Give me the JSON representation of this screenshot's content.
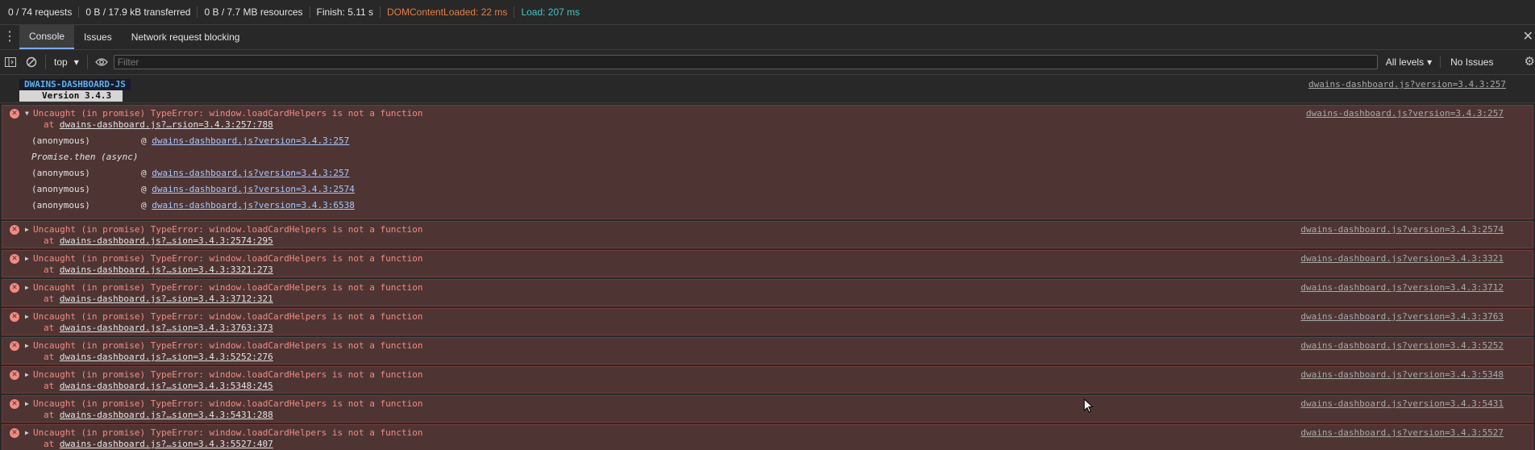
{
  "statusbar": {
    "requests": "0 / 74 requests",
    "transferred": "0 B / 17.9 kB transferred",
    "resources": "0 B / 7.7 MB resources",
    "finish": "Finish: 5.11 s",
    "dom_content_loaded": "DOMContentLoaded: 22 ms",
    "load": "Load: 207 ms"
  },
  "drawer": {
    "tabs": [
      {
        "label": "Console",
        "active": true
      },
      {
        "label": "Issues",
        "active": false
      },
      {
        "label": "Network request blocking",
        "active": false
      }
    ]
  },
  "toolbar": {
    "context": "top",
    "filter_placeholder": "Filter",
    "levels": "All levels",
    "issues": "No Issues"
  },
  "console": {
    "banner": {
      "title": "DWAINS-DASHBOARD-JS",
      "version": "Version 3.4.3",
      "source": "dwains-dashboard.js?version=3.4.3:257"
    },
    "expanded_error": {
      "message": "Uncaught (in promise) TypeError: window.loadCardHelpers is not a function",
      "at_prefix": "at ",
      "location": "dwains-dashboard.js?…rsion=3.4.3:257:788",
      "source": "dwains-dashboard.js?version=3.4.3:257",
      "stack": [
        {
          "fn": "(anonymous)",
          "at": "@",
          "link": "dwains-dashboard.js?version=3.4.3:257"
        },
        {
          "async": "Promise.then (async)"
        },
        {
          "fn": "(anonymous)",
          "at": "@",
          "link": "dwains-dashboard.js?version=3.4.3:257"
        },
        {
          "fn": "(anonymous)",
          "at": "@",
          "link": "dwains-dashboard.js?version=3.4.3:2574"
        },
        {
          "fn": "(anonymous)",
          "at": "@",
          "link": "dwains-dashboard.js?version=3.4.3:6538"
        }
      ]
    },
    "errors": [
      {
        "message": "Uncaught (in promise) TypeError: window.loadCardHelpers is not a function",
        "location": "dwains-dashboard.js?…sion=3.4.3:2574:295",
        "source": "dwains-dashboard.js?version=3.4.3:2574"
      },
      {
        "message": "Uncaught (in promise) TypeError: window.loadCardHelpers is not a function",
        "location": "dwains-dashboard.js?…sion=3.4.3:3321:273",
        "source": "dwains-dashboard.js?version=3.4.3:3321"
      },
      {
        "message": "Uncaught (in promise) TypeError: window.loadCardHelpers is not a function",
        "location": "dwains-dashboard.js?…sion=3.4.3:3712:321",
        "source": "dwains-dashboard.js?version=3.4.3:3712"
      },
      {
        "message": "Uncaught (in promise) TypeError: window.loadCardHelpers is not a function",
        "location": "dwains-dashboard.js?…sion=3.4.3:3763:373",
        "source": "dwains-dashboard.js?version=3.4.3:3763"
      },
      {
        "message": "Uncaught (in promise) TypeError: window.loadCardHelpers is not a function",
        "location": "dwains-dashboard.js?…sion=3.4.3:5252:276",
        "source": "dwains-dashboard.js?version=3.4.3:5252"
      },
      {
        "message": "Uncaught (in promise) TypeError: window.loadCardHelpers is not a function",
        "location": "dwains-dashboard.js?…sion=3.4.3:5348:245",
        "source": "dwains-dashboard.js?version=3.4.3:5348"
      },
      {
        "message": "Uncaught (in promise) TypeError: window.loadCardHelpers is not a function",
        "location": "dwains-dashboard.js?…sion=3.4.3:5431:288",
        "source": "dwains-dashboard.js?version=3.4.3:5431"
      },
      {
        "message": "Uncaught (in promise) TypeError: window.loadCardHelpers is not a function",
        "location": "dwains-dashboard.js?…sion=3.4.3:5527:407",
        "source": "dwains-dashboard.js?version=3.4.3:5527"
      }
    ]
  },
  "colors": {
    "error_bg": "#4e3534",
    "error_text": "#f28b82",
    "dcl": "#e67e45",
    "load": "#47c6c6",
    "link": "#a8c7fa"
  }
}
